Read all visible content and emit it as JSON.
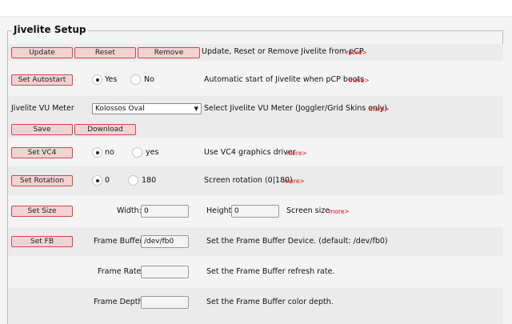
{
  "section_title": "Jivelite Setup",
  "rows": {
    "main": {
      "update_label": "Update",
      "reset_label": "Reset",
      "remove_label": "Remove",
      "description": "Update, Reset or Remove Jivelite from pCP",
      "more": "more>"
    },
    "autostart": {
      "button_label": "Set Autostart",
      "yes_label": "Yes",
      "no_label": "No",
      "selected": "Yes",
      "description": "Automatic start of Jivelite when pCP boots",
      "more": "more>"
    },
    "vu_meter": {
      "label": "Jivelite VU Meter",
      "selected": "Kolossos Oval",
      "description": "Select Jivelite VU Meter (Joggler/Grid Skins only)",
      "more": "more>"
    },
    "save_download": {
      "save_label": "Save",
      "download_label": "Download"
    },
    "vc4": {
      "button_label": "Set VC4",
      "no_label": "no",
      "yes_label": "yes",
      "selected": "no",
      "description": "Use VC4 graphics driver",
      "more": "more>"
    },
    "rotation": {
      "button_label": "Set Rotation",
      "opt0_label": "0",
      "opt180_label": "180",
      "selected": "0",
      "description": "Screen rotation (0|180)",
      "more": "more>"
    },
    "size": {
      "button_label": "Set Size",
      "width_label": "Width:",
      "width_value": "0",
      "height_label": "Height:",
      "height_value": "0",
      "description": "Screen size",
      "more": "more>"
    },
    "fb": {
      "button_label": "Set FB",
      "label": "Frame Buffer:",
      "value": "/dev/fb0",
      "description": "Set the Frame Buffer Device. (default: /dev/fb0)"
    },
    "frame_rate": {
      "label": "Frame Rate:",
      "value": "",
      "description": "Set the Frame Buffer refresh rate."
    },
    "frame_depth": {
      "label": "Frame Depth:",
      "value": "",
      "description": "Set the Frame Buffer color depth."
    }
  },
  "colors": {
    "button_bg": "#f2d2d2",
    "button_border": "#d04848",
    "more_link": "#e01010",
    "row_alt": "#ebebeb"
  }
}
